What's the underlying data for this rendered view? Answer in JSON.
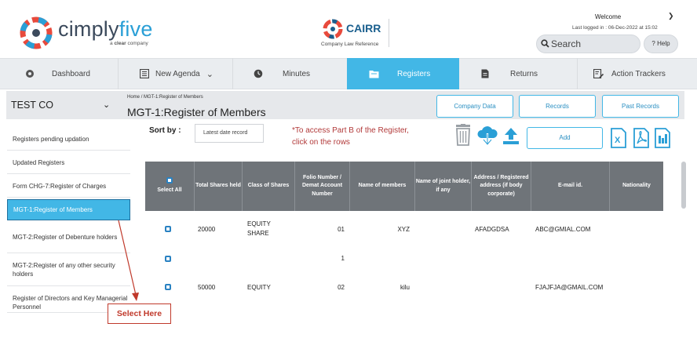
{
  "brand": {
    "name_part1": "cimply",
    "name_part2": "five",
    "sub_prefix": "a",
    "sub_brand": "clear",
    "sub_suffix": "company",
    "cairr_title": "CAIRR",
    "cairr_sub": "Company Law Reference",
    "accent": "#42b7e6"
  },
  "user": {
    "welcome": "Welcome",
    "last_logged": "Last logged in : 06-Dec-2022 at 15:02"
  },
  "search": {
    "label": "Search"
  },
  "help": {
    "label": "Help"
  },
  "nav": {
    "dashboard": "Dashboard",
    "new_agenda": "New Agenda",
    "minutes": "Minutes",
    "registers": "Registers",
    "returns": "Returns",
    "action_trackers": "Action Trackers"
  },
  "company": {
    "name": "TEST CO"
  },
  "sidebar": {
    "items": [
      "Registers pending updation",
      "Updated Registers",
      "Form CHG-7:Register of Charges",
      "MGT-1:Register of Members",
      "MGT-2:Register of Debenture holders",
      "MGT-2:Register of any other security holders",
      "Register of Directors and Key Managerial Personnel"
    ]
  },
  "page": {
    "breadcrumb_home": "Home",
    "breadcrumb_sep": "/",
    "breadcrumb_current": "MGT-1:Register of Members",
    "title": "MGT-1:Register of Members"
  },
  "buttons": {
    "company_data": "Company Data",
    "records": "Records",
    "past_records": "Past Records",
    "add": "Add"
  },
  "toolbar": {
    "sort_label": "Sort by :",
    "sort_value": "Latest date record",
    "note_line1": "*To access Part B of the Register,",
    "note_line2": "click on the rows"
  },
  "table": {
    "headers": [
      "Select All",
      "Total Shares held",
      "Class of Shares",
      "Folio Number / Demat Account Number",
      "Name of members",
      "Name of joint holder, if any",
      "Address / Registered address (if body corporate)",
      "E-mail id.",
      "Nationality"
    ],
    "rows": [
      {
        "shares": "20000",
        "class": "EQUITY SHARE",
        "folio": "01",
        "name": "XYZ",
        "joint": "",
        "address": "AFADGDSA",
        "email": "ABC@GMIAL.COM",
        "nationality": ""
      },
      {
        "shares": "",
        "class": "",
        "folio": "1",
        "name": "",
        "joint": "",
        "address": "",
        "email": "",
        "nationality": ""
      },
      {
        "shares": "50000",
        "class": "EQUITY",
        "folio": "02",
        "name": "kilu",
        "joint": "",
        "address": "",
        "email": "FJAJFJA@GMAIL.COM",
        "nationality": ""
      }
    ]
  },
  "annotation": {
    "label": "Select Here",
    "color": "#c0392b"
  }
}
